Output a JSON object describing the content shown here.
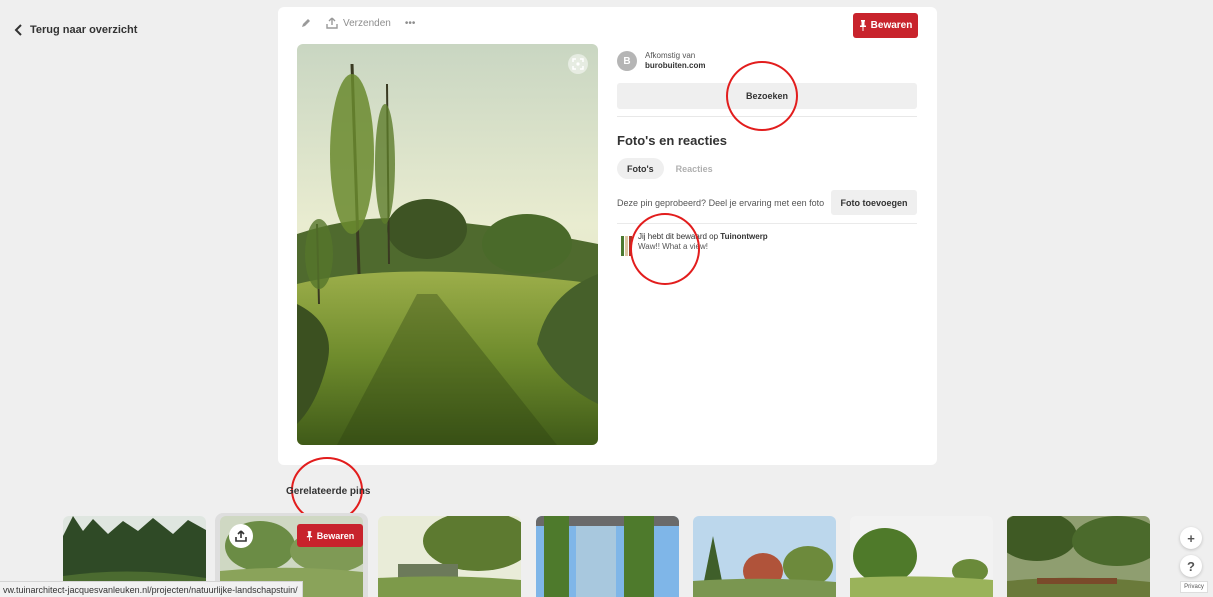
{
  "back": {
    "label": "Terug naar overzicht"
  },
  "toolbar": {
    "send_label": "Verzenden",
    "more_label": "•••"
  },
  "pin": {
    "save_label": "Bewaren",
    "source_label": "Afkomstig van",
    "source_domain": "burobuiten.com",
    "avatar_letter": "B",
    "visit_label": "Bezoeken"
  },
  "photos_section": {
    "title": "Foto's en reacties",
    "tabs": [
      {
        "label": "Foto's",
        "active": true
      },
      {
        "label": "Reacties",
        "active": false
      }
    ],
    "try_prompt": "Deze pin geprobeerd? Deel je ervaring met een foto",
    "add_photo_label": "Foto toevoegen"
  },
  "activity": {
    "saved_prefix": "Jij hebt dit bewaard op",
    "board_name": "Tuinontwerp",
    "note": "Waw!! What a view!"
  },
  "related": {
    "title": "Gerelateerde pins",
    "hover_save_label": "Bewaren"
  },
  "side": {
    "plus": "+",
    "help": "?",
    "privacy": "Privacy"
  },
  "status_url": "vw.tuinarchitect-jacquesvanleuken.nl/projecten/natuurlijke-landschapstuin/",
  "colors": {
    "accent": "#c8232c",
    "annotation": "#e21d1d",
    "background": "#efefef"
  },
  "icons": [
    "chevron-left-icon",
    "pencil-icon",
    "share-icon",
    "more-icon",
    "pin-icon",
    "lens-icon",
    "upload-icon"
  ]
}
